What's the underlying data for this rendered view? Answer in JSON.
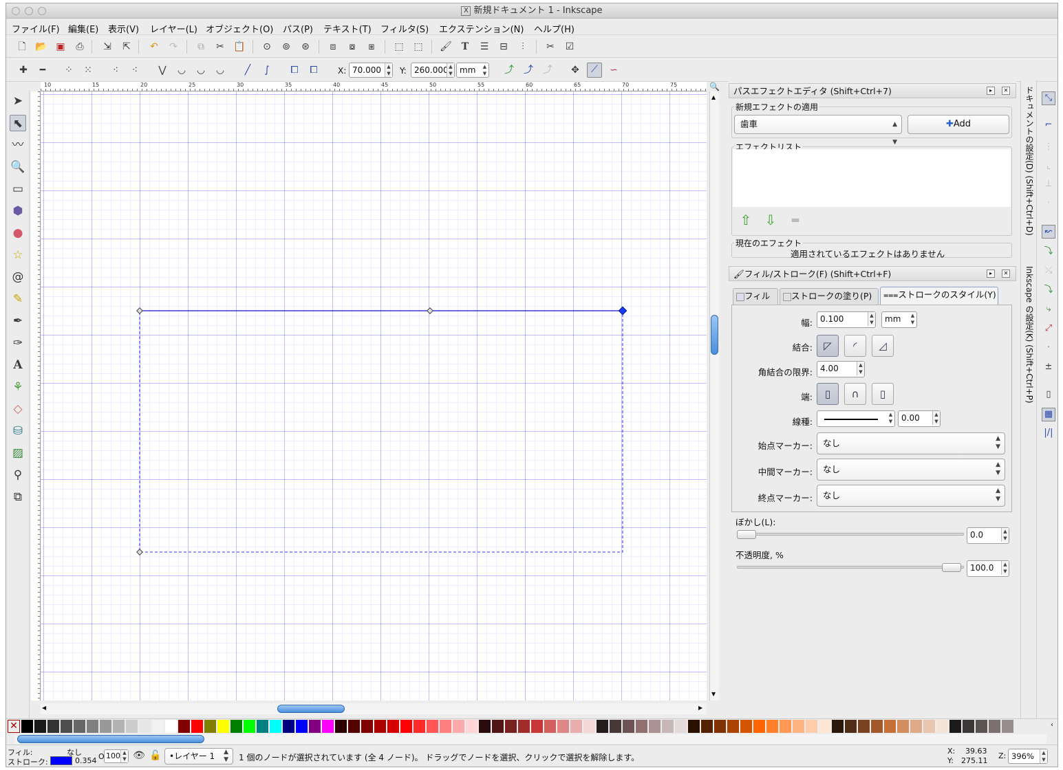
{
  "window": {
    "title": "新規ドキュメント 1 - Inkscape"
  },
  "menu": [
    "ファイル(F)",
    "編集(E)",
    "表示(V)",
    "レイヤー(L)",
    "オブジェクト(O)",
    "パス(P)",
    "テキスト(T)",
    "フィルタ(S)",
    "エクステンション(N)",
    "ヘルプ(H)"
  ],
  "node_toolbar": {
    "x_label": "X:",
    "x_value": "70.000",
    "y_label": "Y:",
    "y_value": "260.000",
    "unit": "mm"
  },
  "ruler": {
    "h_labels": [
      "10",
      "15",
      "20",
      "25",
      "30",
      "35",
      "40",
      "45",
      "50",
      "55",
      "60",
      "65",
      "70",
      "75"
    ]
  },
  "lpe_panel": {
    "title": "パスエフェクトエディタ (Shift+Ctrl+7)",
    "apply_label": "新規エフェクトの適用",
    "effect_select": "歯車",
    "add_button": "Add",
    "effect_list_label": "エフェクトリスト",
    "current_label": "現在のエフェクト",
    "current_value": "適用されているエフェクトはありません"
  },
  "fill_stroke_panel": {
    "title": "フィル/ストローク(F) (Shift+Ctrl+F)",
    "tabs": [
      "フィル",
      "ストロークの塗り(P)",
      "ストロークのスタイル(Y)"
    ],
    "width_label": "幅:",
    "width_value": "0.100",
    "width_unit": "mm",
    "join_label": "結合:",
    "miter_label": "角結合の限界:",
    "miter_value": "4.00",
    "cap_label": "端:",
    "dash_label": "線種:",
    "dash_offset": "0.00",
    "start_marker_label": "始点マーカー:",
    "start_marker_value": "なし",
    "mid_marker_label": "中間マーカー:",
    "mid_marker_value": "なし",
    "end_marker_label": "終点マーカー:",
    "end_marker_value": "なし",
    "blur_label": "ぼかし(L):",
    "blur_value": "0.0",
    "opacity_label": "不透明度, %",
    "opacity_value": "100.0"
  },
  "side_tabs": [
    "ドキュメントの設定(D) (Shift+Ctrl+D)",
    "Inkscape の設定(K) (Shift+Ctrl+P)"
  ],
  "palette": [
    "#000000",
    "#1a1a1a",
    "#333333",
    "#4d4d4d",
    "#666666",
    "#808080",
    "#999999",
    "#b3b3b3",
    "#cccccc",
    "#e6e6e6",
    "#f2f2f2",
    "#ffffff",
    "#800000",
    "#ff0000",
    "#808000",
    "#ffff00",
    "#008000",
    "#00ff00",
    "#008080",
    "#00ffff",
    "#000080",
    "#0000ff",
    "#800080",
    "#ff00ff",
    "#2b0000",
    "#550000",
    "#800000",
    "#aa0000",
    "#d40000",
    "#ff0000",
    "#ff2a2a",
    "#ff5555",
    "#ff8080",
    "#ffaaaa",
    "#ffd5d5",
    "#280b0b",
    "#501616",
    "#782121",
    "#a02c2c",
    "#c83737",
    "#d35f5f",
    "#de8787",
    "#e9afaf",
    "#f4d7d7",
    "#241c1c",
    "#483737",
    "#6c5353",
    "#916f6f",
    "#ac9393",
    "#c8b7b7",
    "#e3dbdb",
    "#2b1100",
    "#552200",
    "#803300",
    "#aa4400",
    "#d45500",
    "#ff6600",
    "#ff7f2a",
    "#ff9955",
    "#ffb380",
    "#ffccaa",
    "#ffe6d5",
    "#28170b",
    "#502d16",
    "#784421",
    "#a05a2c",
    "#c87137",
    "#d38d5f",
    "#deaa87",
    "#e9c6af",
    "#f4e3d7",
    "#1c1a1a",
    "#3c3737",
    "#5c5353",
    "#7b6f6f",
    "#998e8e"
  ],
  "status": {
    "fill_label": "フィル:",
    "fill_value": "なし",
    "stroke_label": "ストローク:",
    "stroke_color": "#0000ff",
    "stroke_width": "0.354",
    "opacity_label": "O:",
    "opacity_value": "100",
    "layer": "•レイヤー 1",
    "message": "1 個のノードが選択されています (全 4 ノード)。 ドラッグでノードを選択、クリックで選択を解除します。",
    "x_label": "X:",
    "x_value": "39.63",
    "y_label": "Y:",
    "y_value": "275.11",
    "zoom_label": "Z:",
    "zoom_value": "396%"
  }
}
